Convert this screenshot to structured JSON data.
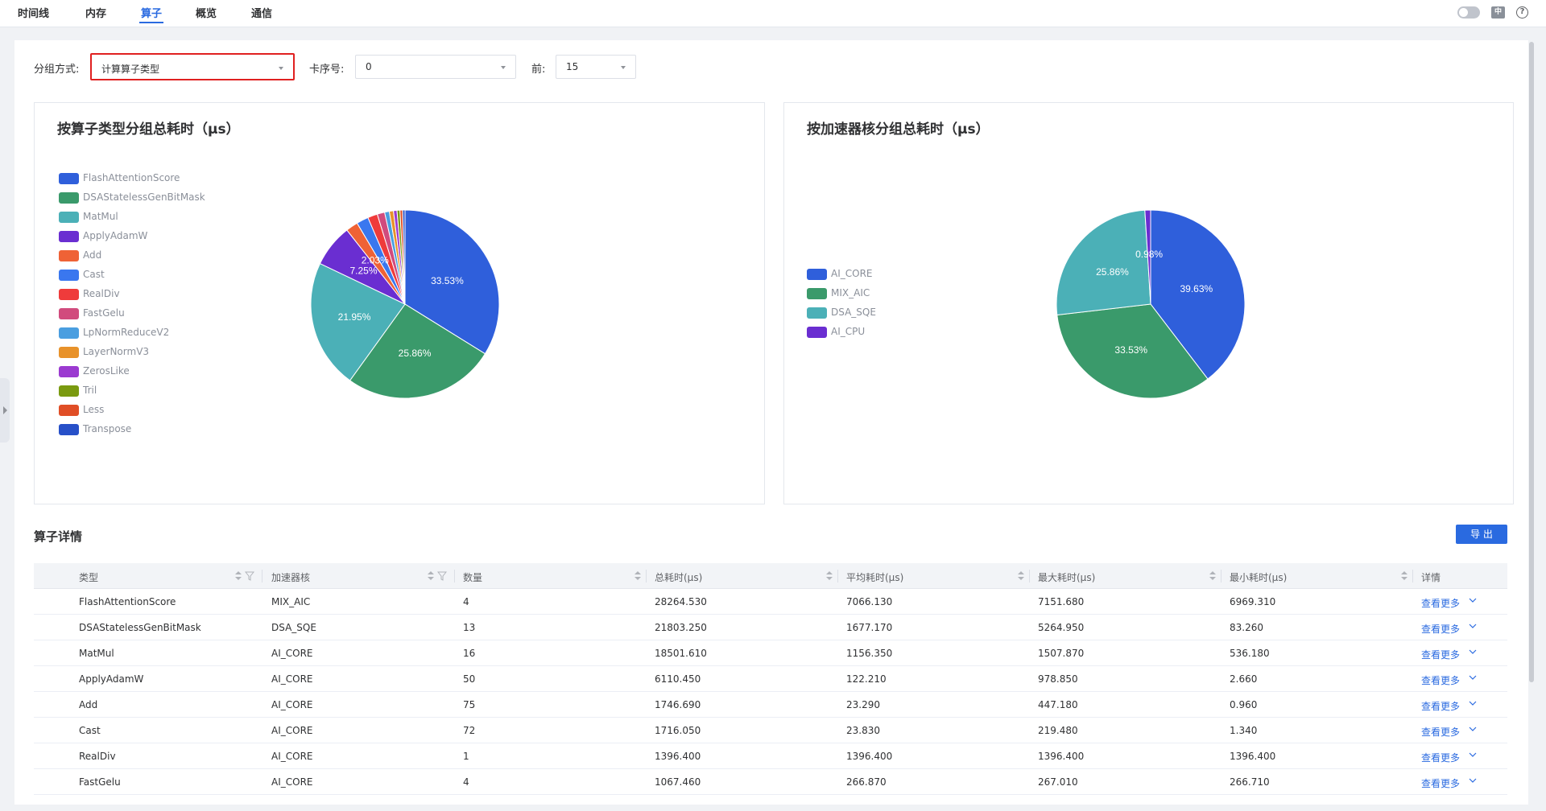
{
  "nav": {
    "tabs": [
      {
        "label": "时间线"
      },
      {
        "label": "内存"
      },
      {
        "label": "算子"
      },
      {
        "label": "概览"
      },
      {
        "label": "通信"
      }
    ],
    "active_tab": "算子",
    "lang_icon": "中",
    "help_icon": "?"
  },
  "filters": {
    "group_label": "分组方式:",
    "group_value": "计算算子类型",
    "card_label": "卡序号:",
    "card_value": "0",
    "top_label": "前:",
    "top_value": "15"
  },
  "charts": {
    "left_title": "按算子类型分组总耗时（μs）",
    "right_title": "按加速器核分组总耗时（μs）"
  },
  "chart_data": [
    {
      "type": "pie",
      "title": "按算子类型分组总耗时（μs）",
      "categories": [
        "FlashAttentionScore",
        "DSAStatelessGenBitMask",
        "MatMul",
        "ApplyAdamW",
        "Add",
        "Cast",
        "RealDiv",
        "FastGelu",
        "LpNormReduceV2",
        "LayerNormV3",
        "ZerosLike",
        "Tril",
        "Less",
        "Transpose"
      ],
      "values": [
        33.53,
        25.86,
        21.95,
        7.25,
        2.07,
        2.04,
        1.66,
        1.27,
        0.8,
        0.7,
        0.6,
        0.5,
        0.45,
        0.4
      ],
      "data_labels": [
        "33.53%",
        "25.86%",
        "21.95%",
        "7.25%",
        "2.03%"
      ],
      "colors": [
        "#2f5fdb",
        "#3a9a6b",
        "#4bb0b7",
        "#6a2ed1",
        "#ef6236",
        "#3a77ef",
        "#ef3b3b",
        "#d14b7d",
        "#4a9ee0",
        "#e8922a",
        "#9b3ad0",
        "#7a9a10",
        "#e04e26",
        "#2750c8"
      ],
      "legend": "left"
    },
    {
      "type": "pie",
      "title": "按加速器核分组总耗时（μs）",
      "categories": [
        "AI_CORE",
        "MIX_AIC",
        "DSA_SQE",
        "AI_CPU"
      ],
      "values": [
        39.63,
        33.53,
        25.86,
        0.98
      ],
      "data_labels": [
        "39.63%",
        "33.53%",
        "25.86%",
        "0.98%"
      ],
      "colors": [
        "#2f5fdb",
        "#3a9a6b",
        "#4bb0b7",
        "#6a2ed1"
      ],
      "legend": "left"
    }
  ],
  "details": {
    "title": "算子详情",
    "export_label": "导 出",
    "columns": [
      "类型",
      "加速器核",
      "数量",
      "总耗时(μs)",
      "平均耗时(μs)",
      "最大耗时(μs)",
      "最小耗时(μs)",
      "详情"
    ],
    "more_label": "查看更多",
    "rows": [
      [
        "FlashAttentionScore",
        "MIX_AIC",
        "4",
        "28264.530",
        "7066.130",
        "7151.680",
        "6969.310"
      ],
      [
        "DSAStatelessGenBitMask",
        "DSA_SQE",
        "13",
        "21803.250",
        "1677.170",
        "5264.950",
        "83.260"
      ],
      [
        "MatMul",
        "AI_CORE",
        "16",
        "18501.610",
        "1156.350",
        "1507.870",
        "536.180"
      ],
      [
        "ApplyAdamW",
        "AI_CORE",
        "50",
        "6110.450",
        "122.210",
        "978.850",
        "2.660"
      ],
      [
        "Add",
        "AI_CORE",
        "75",
        "1746.690",
        "23.290",
        "447.180",
        "0.960"
      ],
      [
        "Cast",
        "AI_CORE",
        "72",
        "1716.050",
        "23.830",
        "219.480",
        "1.340"
      ],
      [
        "RealDiv",
        "AI_CORE",
        "1",
        "1396.400",
        "1396.400",
        "1396.400",
        "1396.400"
      ],
      [
        "FastGelu",
        "AI_CORE",
        "4",
        "1067.460",
        "266.870",
        "267.010",
        "266.710"
      ]
    ]
  }
}
